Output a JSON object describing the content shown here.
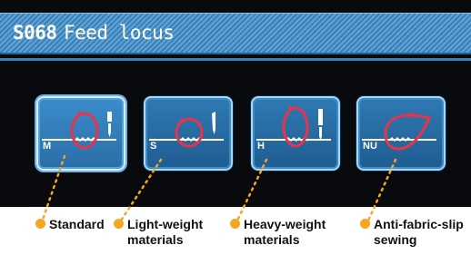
{
  "header": {
    "code": "S068",
    "title": "Feed locus"
  },
  "modes": [
    {
      "letter": "M",
      "label_line1": "Standard",
      "label_line2": "",
      "selected": true
    },
    {
      "letter": "S",
      "label_line1": "Light-weight",
      "label_line2": "materials",
      "selected": false
    },
    {
      "letter": "H",
      "label_line1": "Heavy-weight",
      "label_line2": "materials",
      "selected": false
    },
    {
      "letter": "NU",
      "label_line1": "Anti-fabric-slip",
      "label_line2": "sewing",
      "selected": false
    }
  ],
  "colors": {
    "accent": "#3c7fb6",
    "button": "#2f79b2",
    "locus": "#e8344a",
    "callout": "#f5a623"
  },
  "icons": [
    "feed-locus-icon",
    "needle-icon",
    "feed-dog-icon"
  ]
}
